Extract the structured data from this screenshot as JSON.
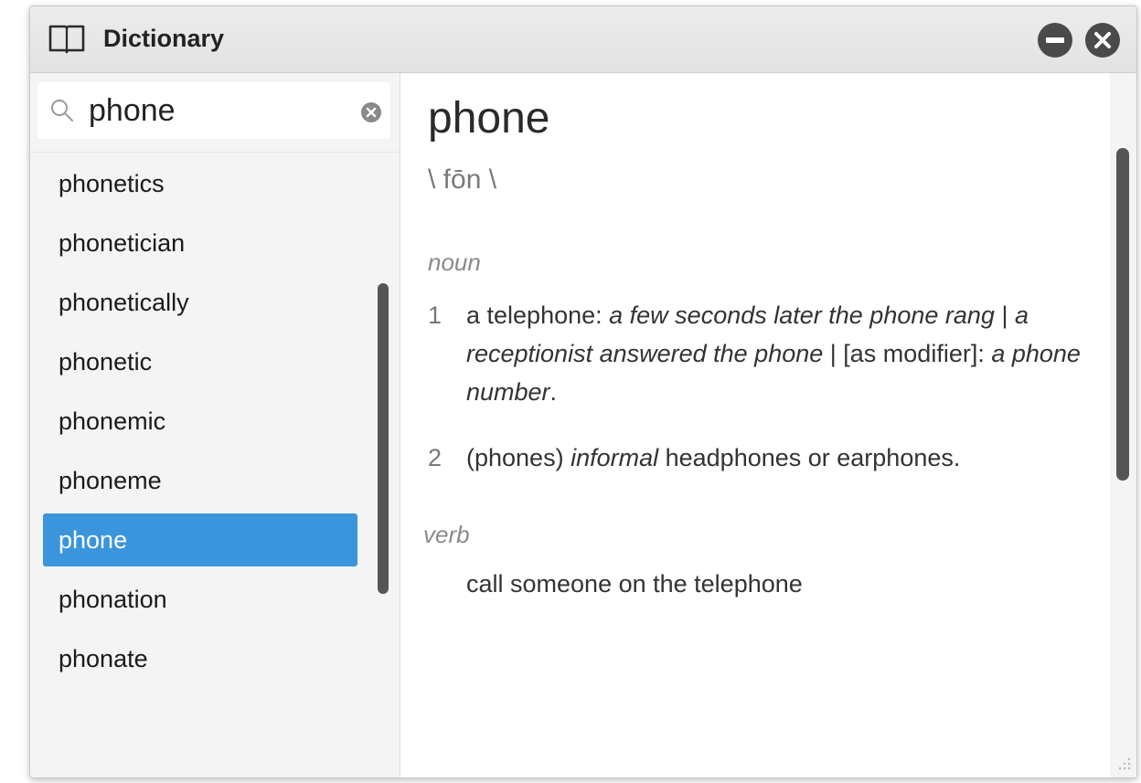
{
  "window": {
    "title": "Dictionary",
    "icons": {
      "app": "book-icon",
      "minimize": "minimize-icon",
      "close": "close-icon"
    }
  },
  "search": {
    "value": "phone",
    "icon": "search-icon",
    "clear_icon": "clear-icon"
  },
  "word_list": {
    "items": [
      {
        "label": "phonetics",
        "selected": false
      },
      {
        "label": "phonetician",
        "selected": false
      },
      {
        "label": "phonetically",
        "selected": false
      },
      {
        "label": "phonetic",
        "selected": false
      },
      {
        "label": "phonemic",
        "selected": false
      },
      {
        "label": "phoneme",
        "selected": false
      },
      {
        "label": "phone",
        "selected": true
      },
      {
        "label": "phonation",
        "selected": false
      },
      {
        "label": "phonate",
        "selected": false
      }
    ]
  },
  "entry": {
    "headword": "phone",
    "pronunciation": "\\ fōn \\",
    "noun": {
      "label": "noun",
      "senses": [
        {
          "number": "1",
          "parts": [
            {
              "text": "a telephone: ",
              "italic": false
            },
            {
              "text": "a few seconds later the phone rang",
              "italic": true
            },
            {
              "text": " | ",
              "italic": false
            },
            {
              "text": "a receptionist answered the phone",
              "italic": true
            },
            {
              "text": " | [as modifier]: ",
              "italic": false
            },
            {
              "text": "a phone number",
              "italic": true
            },
            {
              "text": ".",
              "italic": false
            }
          ]
        },
        {
          "number": "2",
          "parts": [
            {
              "text": "(phones) ",
              "italic": false
            },
            {
              "text": "informal",
              "italic": true
            },
            {
              "text": " headphones or earphones.",
              "italic": false
            }
          ]
        }
      ]
    },
    "verb": {
      "label": "verb",
      "definition": "call someone on the telephone"
    }
  },
  "colors": {
    "selection": "#3a95dd",
    "scrollbar": "#555555",
    "titlebar": "#e6e6e6"
  }
}
